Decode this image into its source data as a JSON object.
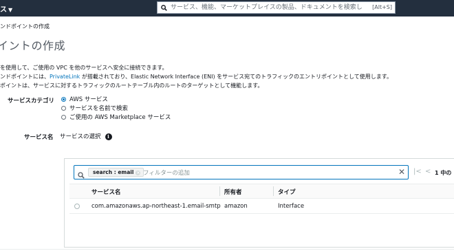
{
  "topbar": {
    "services_label": "ス",
    "services_caret": "▼",
    "search_placeholder": "サービス、機能、マーケットプレイスの製品、ドキュメントを検索し",
    "search_shortcut": "[Alt+S]"
  },
  "breadcrumb": "ンドポイントの作成",
  "page_title": "イントの作成",
  "description": {
    "line1": "を使用して、ご使用の VPC を他のサービスへ安全に接続できます。",
    "line2_prefix": "ンドポイントには、",
    "line2_link": "PrivateLink",
    "line2_suffix": " が搭載されており、Elastic Network Interface (ENI) をサービス宛てのトラフィックのエントリポイントとして使用します。",
    "line3": "ポイントは、サービスに対するトラフィックのルートテーブル内のルートのターゲットとして機能します。"
  },
  "service_category": {
    "label": "サービスカテゴリ",
    "options": [
      {
        "label": "AWS サービス",
        "selected": true
      },
      {
        "label": "サービスを名前で検索",
        "selected": false
      },
      {
        "label": "ご使用の AWS Marketplace サービス",
        "selected": false
      }
    ]
  },
  "service_name": {
    "label": "サービス名",
    "value": "サービスの選択",
    "info_icon": "i"
  },
  "filter": {
    "token": "search : email",
    "token_close": "×",
    "placeholder": "フィルターの追加",
    "clear": "✕"
  },
  "pagination": {
    "first": "|<",
    "prev": "<",
    "info": "1 中の"
  },
  "table": {
    "columns": [
      "サービス名",
      "所有者",
      "タイプ"
    ],
    "rows": [
      {
        "service_name": "com.amazonaws.ap-northeast-1.email-smtp",
        "owner": "amazon",
        "type": "Interface"
      }
    ]
  }
}
